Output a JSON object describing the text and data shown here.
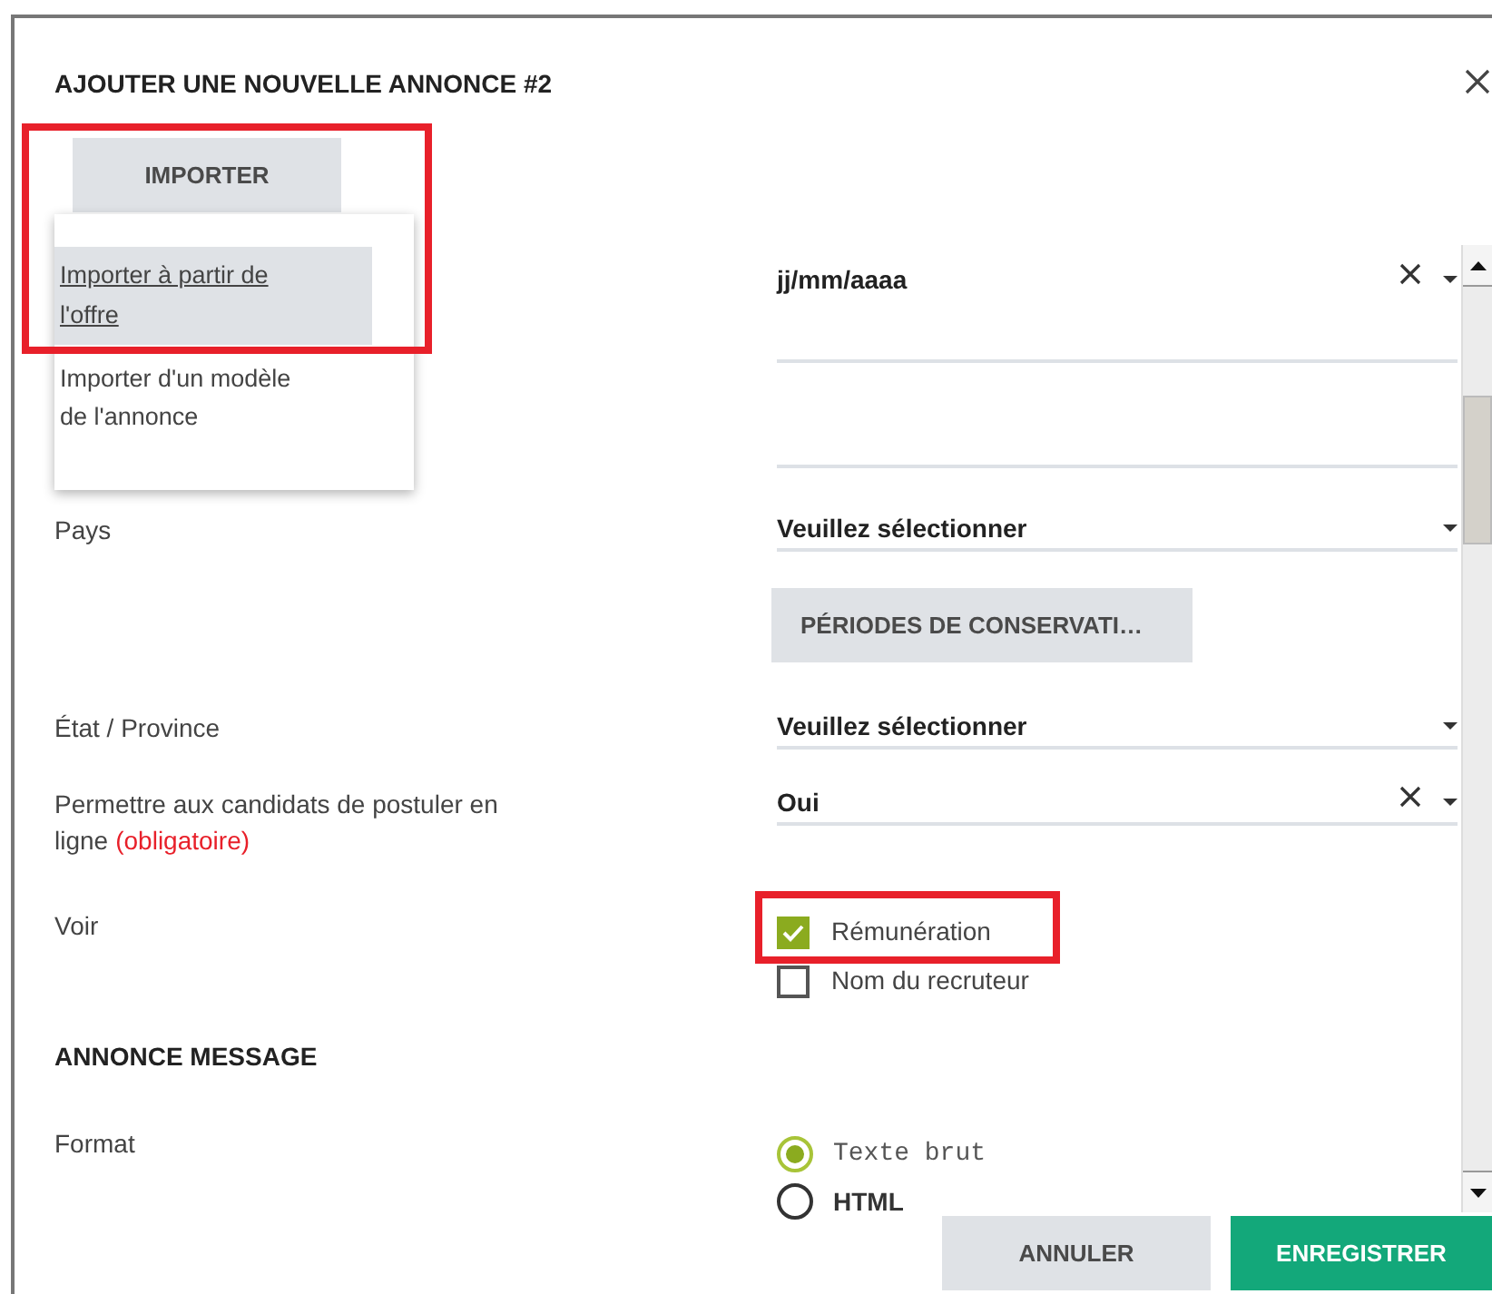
{
  "dialog": {
    "title": "AJOUTER UNE NOUVELLE ANNONCE #2",
    "import_button": {
      "label": "IMPORTER",
      "expanded": true
    },
    "import_menu": {
      "highlighted": true,
      "items": [
        {
          "label": "Importer à partir de l'offre",
          "selected": true
        },
        {
          "label": "Importer d'un modèle de l'annonce",
          "selected": false
        }
      ]
    },
    "form": {
      "rows": [
        {
          "kind": "select",
          "value": "jj/mm/aaaa",
          "clearable": true
        },
        {
          "kind": "text"
        },
        {
          "kind": "select",
          "label": "Pays",
          "value": "Veuillez sélectionner",
          "clearable": false
        },
        {
          "kind": "button",
          "label": "PÉRIODES DE CONSERVATI…"
        },
        {
          "kind": "select",
          "label": "État / Province",
          "value": "Veuillez sélectionner",
          "clearable": false
        },
        {
          "kind": "select",
          "label": "Permettre aux candidats de postuler en ligne",
          "note": "(obligatoire)",
          "value": "Oui",
          "clearable": true
        },
        {
          "kind": "checkboxes",
          "label": "Voir",
          "options": [
            {
              "label": "Rémunération",
              "checked": true,
              "highlighted": true
            },
            {
              "label": "Nom du recruteur",
              "checked": false,
              "highlighted": false
            }
          ]
        },
        {
          "kind": "heading",
          "label": "ANNONCE MESSAGE"
        },
        {
          "kind": "radios",
          "label": "Format",
          "options": [
            {
              "label": "Texte brut",
              "selected": true,
              "kind": "plain"
            },
            {
              "label": "HTML",
              "selected": false,
              "kind": "html"
            }
          ]
        }
      ]
    },
    "footer": {
      "buttons": [
        {
          "label": "ANNULER",
          "kind": "secondary"
        },
        {
          "label": "ENREGISTRER",
          "kind": "primary"
        }
      ]
    }
  }
}
